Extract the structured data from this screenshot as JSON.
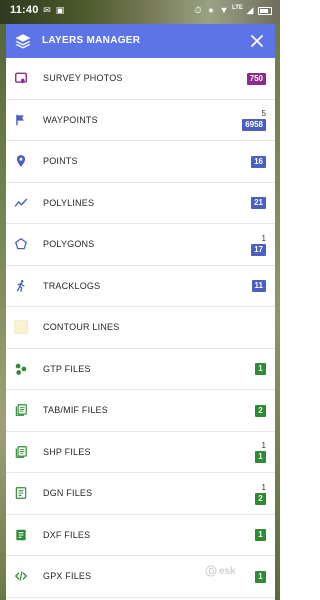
{
  "status_bar": {
    "time": "11:40",
    "network_label": "LTE"
  },
  "header": {
    "title": "LAYERS MANAGER",
    "icon": "layers-icon",
    "close_icon": "close-icon"
  },
  "colors": {
    "header": "#5d74e8",
    "badge_purple": "#8e2a8e",
    "badge_blue": "#4a5fc1",
    "badge_green": "#2e8b33"
  },
  "layers": [
    {
      "label": "SURVEY PHOTOS",
      "icon": "photo-pin-icon",
      "sub": "",
      "count": "750",
      "badge": "purple"
    },
    {
      "label": "WAYPOINTS",
      "icon": "flag-icon",
      "sub": "5",
      "count": "6958",
      "badge": "blue"
    },
    {
      "label": "POINTS",
      "icon": "location-pin-icon",
      "sub": "",
      "count": "16",
      "badge": "blue"
    },
    {
      "label": "POLYLINES",
      "icon": "polyline-icon",
      "sub": "",
      "count": "21",
      "badge": "blue"
    },
    {
      "label": "POLYGONS",
      "icon": "pentagon-icon",
      "sub": "1",
      "count": "17",
      "badge": "blue"
    },
    {
      "label": "TRACKLOGS",
      "icon": "walking-icon",
      "sub": "",
      "count": "11",
      "badge": "blue"
    },
    {
      "label": "CONTOUR LINES",
      "icon": "contour-square-icon",
      "sub": "",
      "count": "",
      "badge": ""
    },
    {
      "label": "GTP FILES",
      "icon": "dots-cluster-icon",
      "sub": "",
      "count": "1",
      "badge": "green"
    },
    {
      "label": "TAB/MIF FILES",
      "icon": "stacked-file-icon",
      "sub": "",
      "count": "2",
      "badge": "green"
    },
    {
      "label": "SHP FILES",
      "icon": "stacked-file-icon",
      "sub": "1",
      "count": "1",
      "badge": "green"
    },
    {
      "label": "DGN FILES",
      "icon": "file-lines-icon",
      "sub": "1",
      "count": "2",
      "badge": "green"
    },
    {
      "label": "DXF FILES",
      "icon": "file-lines-filled-icon",
      "sub": "",
      "count": "1",
      "badge": "green"
    },
    {
      "label": "GPX FILES",
      "icon": "code-icon",
      "sub": "",
      "count": "1",
      "badge": "green"
    }
  ]
}
